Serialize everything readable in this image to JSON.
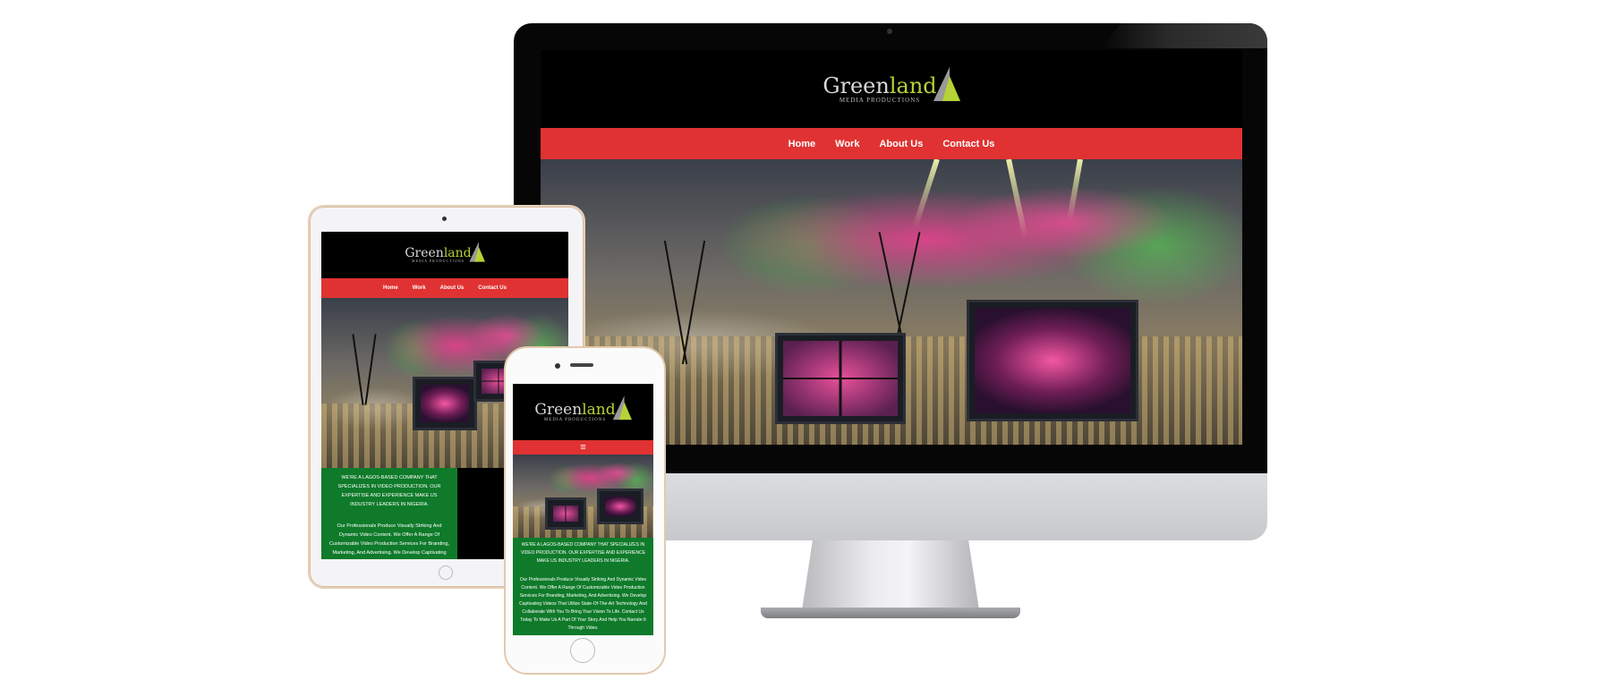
{
  "brand": {
    "name_part1": "Green",
    "name_part2": "land",
    "tagline": "MEDIA PRODUCTIONS"
  },
  "nav": {
    "items": [
      "Home",
      "Work",
      "About Us",
      "Contact Us"
    ],
    "menu_icon": "hamburger-menu-icon",
    "menu_glyph": "≡"
  },
  "intro": {
    "headline": "WE'RE A LAGOS-BASED COMPANY THAT SPECIALIZES IN VIDEO PRODUCTION. OUR EXPERTISE AND EXPERIENCE MAKE US INDUSTRY LEADERS IN NIGERIA.",
    "body": "Our Professionals Produce Visually Striking And Dynamic Video Content. We Offer A Range Of Customizable Video Production Services For Branding, Marketing, And Advertising. We Develop Captivating Videos That Utilize State-Of-The-Art Technology And Collaborate With You To Bring Your Vision To Life. Contact Us Today To Make Us A Part Of Your Story And Help You Narrate It Through Video."
  },
  "colors": {
    "header_bg": "#000000",
    "nav_bg": "#e03232",
    "content_bg": "#0f7a2a",
    "logo_accent": "#b5d334"
  },
  "devices": {
    "desktop_logo_icon": "apple-logo-icon",
    "apple_glyph": ""
  }
}
